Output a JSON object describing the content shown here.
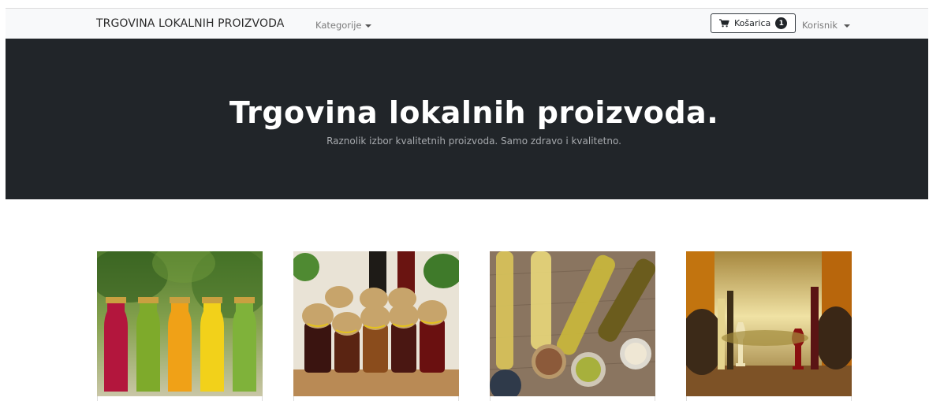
{
  "navbar": {
    "brand": "TRGOVINA LOKALNIH PROIZVODA",
    "categories_label": "Kategorije",
    "cart_label": "Košarica",
    "cart_count": "1",
    "user_label": "Korisnik"
  },
  "hero": {
    "title": "Trgovina lokalnih proizvoda.",
    "subtitle": "Raznolik izbor kvalitetnih proizvoda. Samo zdravo i kvalitetno."
  },
  "products": [
    {
      "image": "juice-bottles"
    },
    {
      "image": "jars-preserves"
    },
    {
      "image": "oil-bottles"
    },
    {
      "image": "wine-barrels"
    }
  ],
  "colors": {
    "navbar_bg": "#f8f9fa",
    "hero_bg": "#212529",
    "badge_bg": "#212529"
  }
}
